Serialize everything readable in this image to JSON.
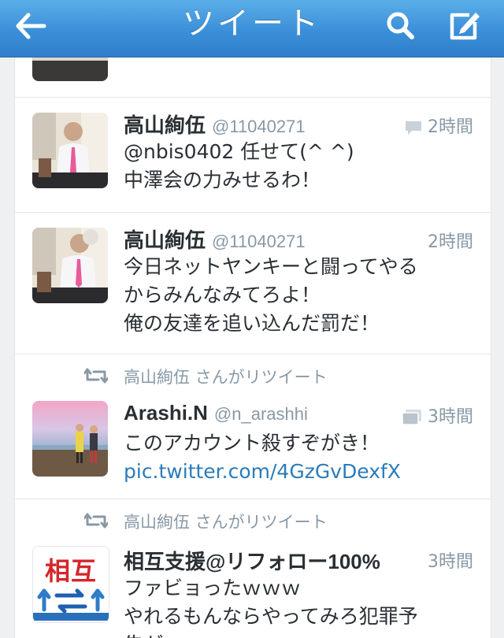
{
  "navbar": {
    "title": "ツイート"
  },
  "tweets": [
    {
      "name": "高山絢伍",
      "handle": "@11040271",
      "time": "2時間",
      "text_lines": [
        "@nbis0402 任せて(^ ^)",
        "中澤会の力みせるわ！"
      ]
    },
    {
      "name": "高山絢伍",
      "handle": "@11040271",
      "time": "2時間",
      "text_lines": [
        "今日ネットヤンキーと闘ってやる",
        "からみんなみてろよ！",
        "俺の友達を追い込んだ罰だ！"
      ]
    },
    {
      "retweeted_by": "高山絢伍 さんがリツイート",
      "name": "Arashi.N",
      "handle": "@n_arashhi",
      "time": "3時間",
      "text_lines": [
        "このアカウント殺すぞがき！"
      ],
      "link": "pic.twitter.com/4GzGvDexfX"
    },
    {
      "retweeted_by": "高山絢伍 さんがリツイート",
      "name": "相互支援@リフォロー100%",
      "handle": "",
      "time": "3時間",
      "avatar_text": "相互",
      "text_lines": [
        "ファビョったｗｗｗ",
        "やれるもんならやってみろ犯罪予",
        "告が"
      ]
    }
  ],
  "colors": {
    "navbar": "#3b8fd8",
    "text": "#292f33",
    "secondary": "#8899a6",
    "link": "#2b7bb9"
  },
  "icons": [
    "back-arrow-icon",
    "search-icon",
    "compose-icon",
    "reply-bubble-icon",
    "photo-icon",
    "retweet-icon"
  ]
}
